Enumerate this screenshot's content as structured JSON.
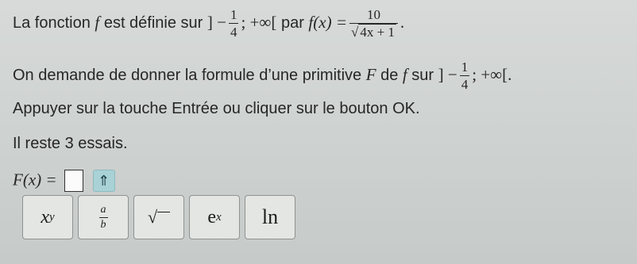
{
  "line1": {
    "intro": "La fonction ",
    "f": "f",
    "mid": " est définie sur ",
    "interval_open": "] −",
    "quarter_num": "1",
    "quarter_den": "4",
    "interval_close": "; +∞[",
    "par": " par ",
    "fx": "f(x) =",
    "num": "10",
    "den": "4x + 1",
    "den_prefix": "√",
    "end": "."
  },
  "line2": {
    "intro": "On demande de donner la formule d’une primitive ",
    "F": "F",
    "de": " de ",
    "f": "f",
    "sur": " sur ",
    "interval_open": "] −",
    "quarter_num": "1",
    "quarter_den": "4",
    "interval_close": "; +∞[."
  },
  "line3": "Appuyer sur la touche Entrée ou cliquer sur le bouton OK.",
  "line4": "Il reste 3 essais.",
  "answer": {
    "label": "F(x) =",
    "arrow": "⇑"
  },
  "keyboard": {
    "power_base": "x",
    "power_exp": "y",
    "frac_num": "a",
    "frac_den": "b",
    "sqrt": "√",
    "exp_base": "e",
    "exp_exp": "x",
    "ln": "ln"
  }
}
